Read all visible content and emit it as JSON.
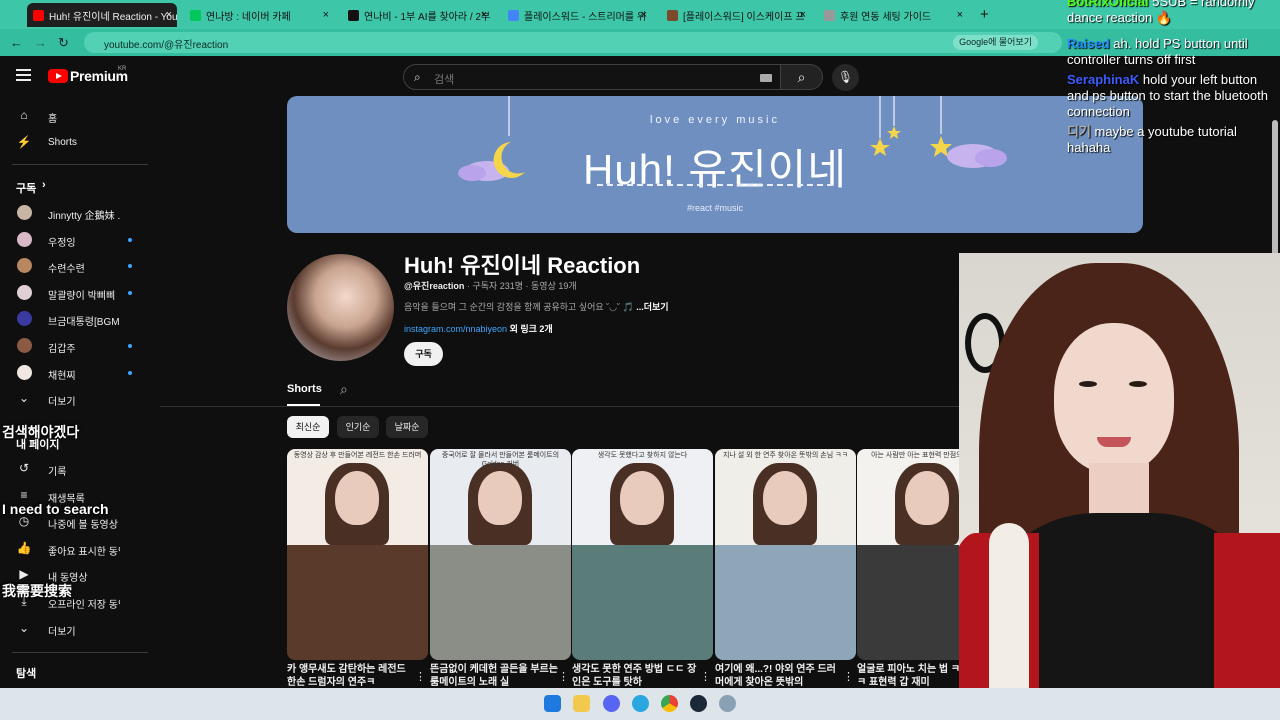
{
  "browser": {
    "tabs": [
      {
        "label": "Huh! 유진이네 Reaction - You",
        "active": true,
        "favicon_color": "#ff0000"
      },
      {
        "label": "연나방 : 네이버 카페",
        "active": false,
        "favicon_color": "#03c75a"
      },
      {
        "label": "연나비 - 1부 AI를 찾아라 / 2부",
        "active": false,
        "favicon_color": "#111111"
      },
      {
        "label": "플레이스워드 - 스트리머를 위",
        "active": false,
        "favicon_color": "#4285f4"
      },
      {
        "label": "[플레이스워드] 이스케이프 프",
        "active": false,
        "favicon_color": "#7b4a2a"
      },
      {
        "label": "후원 연동 세팅 가이드",
        "active": false,
        "favicon_color": "#999999"
      }
    ],
    "url": "youtube.com/@유진reaction",
    "google_chip": "Google에 물어보기"
  },
  "youtube": {
    "logo_text": "Premium",
    "logo_region": "KR",
    "search_placeholder": "검색",
    "sidebar": {
      "main": [
        {
          "label": "홈",
          "icon": "home-icon",
          "glyph": "⌂"
        },
        {
          "label": "Shorts",
          "icon": "shorts-icon",
          "glyph": "⚡"
        }
      ],
      "subs_heading": "구독",
      "subs": [
        {
          "label": "Jinnytty 企鵝妹 ...",
          "color": "#c7b5a5",
          "live": false,
          "flag": true
        },
        {
          "label": "우정잉",
          "color": "#d9b8c8",
          "live": true
        },
        {
          "label": "수련수련",
          "color": "#b8865f",
          "live": true
        },
        {
          "label": "말괄량이 박삐삐",
          "color": "#e0d0d6",
          "live": true
        },
        {
          "label": "브금대통령[BGM ...",
          "color": "#3a3aa0",
          "live": false
        },
        {
          "label": "김갑주",
          "color": "#8a5a44",
          "live": true
        },
        {
          "label": "채현찌",
          "color": "#f0e8e0",
          "live": true
        }
      ],
      "subs_more": "더보기",
      "my_heading": "내 페이지",
      "my": [
        {
          "label": "기록",
          "glyph": "↺"
        },
        {
          "label": "재생목록",
          "glyph": "≡"
        },
        {
          "label": "나중에 볼 동영상",
          "glyph": "◷"
        },
        {
          "label": "좋아요 표시한 동영상",
          "glyph": "👍"
        },
        {
          "label": "내 동영상",
          "glyph": "▶"
        },
        {
          "label": "오프라인 저장 동영상",
          "glyph": "⤓"
        }
      ],
      "my_more": "더보기",
      "explore_heading": "탐색"
    },
    "overlay_subtitles": [
      "검색해야겠다",
      "I need to search",
      "我需要搜索"
    ],
    "banner": {
      "tagline": "love every music",
      "title": "Huh! 유진이네",
      "tags": "#react #music"
    },
    "channel": {
      "name": "Huh! 유진이네 Reaction",
      "handle": "@유진reaction",
      "stats": "· 구독자 231명 · 동영상 19개",
      "description": "음악을 들으며 그 순간의 감정을 함께 공유하고 싶어요 ˘◡˘ 🎵",
      "more": "...더보기",
      "link": "instagram.com/nnabiyeon",
      "link_extra": " 외 링크 2개",
      "subscribe": "구독"
    },
    "tabs": {
      "shorts": "Shorts"
    },
    "chips": [
      {
        "label": "최신순",
        "selected": true
      },
      {
        "label": "인기순",
        "selected": false
      },
      {
        "label": "날짜순",
        "selected": false
      }
    ],
    "shorts": [
      {
        "caption": "동영상 감상 후 만들어본\n레전드 한손 드러머",
        "title": "카 앵무새도 감탄하는 레전드 한손 드럼자의 연주ㅋ",
        "bg_top": "#f2ece4",
        "bg_bottom": "#5a3a2a"
      },
      {
        "caption": "중국어로 잘 몰라서 만들어본\n룸메이트의 Golden 커버",
        "title": "뜬금없이 케데헌 골든을 부르는 룸메이트의 노래 실",
        "bg_top": "#e8ecf0",
        "bg_bottom": "#8a8e86"
      },
      {
        "caption": "생각도 못했다고\n찾하지 않는다",
        "title": "생각도 못한 연주 방법 ㄷㄷ 장인은 도구를 탓하",
        "bg_top": "#eef0f4",
        "bg_bottom": "#5b7d7a"
      },
      {
        "caption": "지나 설 외 한 연주\n찾아온 뜻밖의 손님 ㅋㅋ",
        "title": "여기에 왜...?! 야외 연주 드러머에게 찾아온 뜻밖의",
        "bg_top": "#f0eee8",
        "bg_bottom": "#8fa5b8"
      },
      {
        "caption": "아는 사람만 아는\n표현력 만점의 피아노",
        "title": "얼굴로 피아노 치는 법 ㅋㅋㅋㅋ 표현력 갑 재미",
        "bg_top": "#f4f2ee",
        "bg_bottom": "#3a3a3a"
      }
    ]
  },
  "chat": [
    {
      "name": "BotRixOficial",
      "text": "5SUB = randomly dance reaction 🔥",
      "color": "#53fc18"
    },
    {
      "name": "Raised",
      "text": "ah. hold PS button until controller turns off first",
      "color": "#1e90ff"
    },
    {
      "name": "SeraphinaK",
      "text": "hold your left button and ps button to start the bluetooth connection",
      "color": "#3c5cff"
    },
    {
      "name": "디기",
      "text": "maybe a youtube tutorial hahaha",
      "color": "#aaaaaa"
    }
  ]
}
